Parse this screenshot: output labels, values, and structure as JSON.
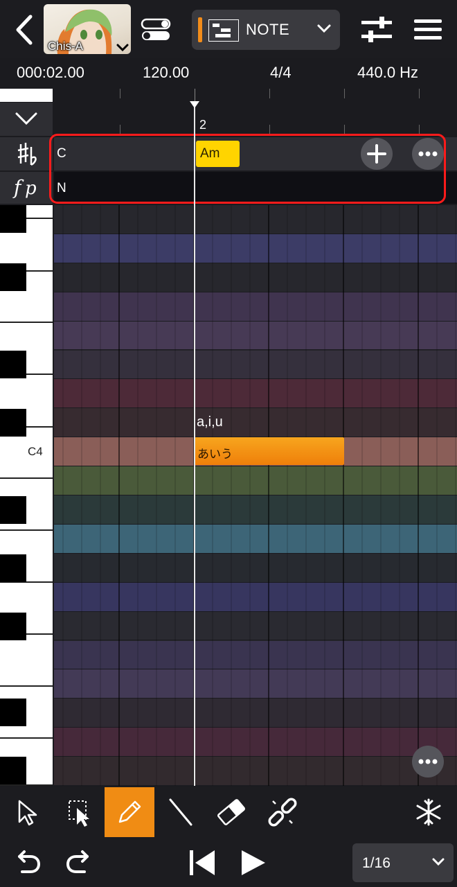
{
  "header": {
    "singer_name": "Chis-A",
    "mode_label": "NOTE"
  },
  "status": {
    "position": "000:02.00",
    "tempo": "120.00",
    "time_signature": "4/4",
    "tuning": "440.0 Hz"
  },
  "ruler": {
    "bar_number": "2"
  },
  "chord_track": {
    "key": "C",
    "chord": "Am"
  },
  "dynamics_track": {
    "value": "N"
  },
  "keyboard": {
    "c4_label": "C4"
  },
  "note": {
    "phonemes": "a,i,u",
    "lyric": "あいう"
  },
  "footer": {
    "quantize": "1/16"
  },
  "colors": {
    "accent": "#f28c1a",
    "chord_chip": "#ffd400",
    "highlight_border": "#ff1b1b",
    "note": "#f28c1a"
  },
  "icons": {
    "back": "chevron-left-icon",
    "toggle": "toggle-icon",
    "mode": "note-mode-icon",
    "mixer": "mixer-icon",
    "menu": "hamburger-menu-icon",
    "key": "sharp-flat-icon",
    "dynamics": "fp-dynamics-icon",
    "tools": [
      "arrow-select-icon",
      "range-select-icon",
      "pencil-icon",
      "line-icon",
      "eraser-icon",
      "link-icon",
      "freeze-icon"
    ],
    "transport": [
      "undo-icon",
      "redo-icon",
      "skip-to-start-icon",
      "play-icon"
    ]
  }
}
